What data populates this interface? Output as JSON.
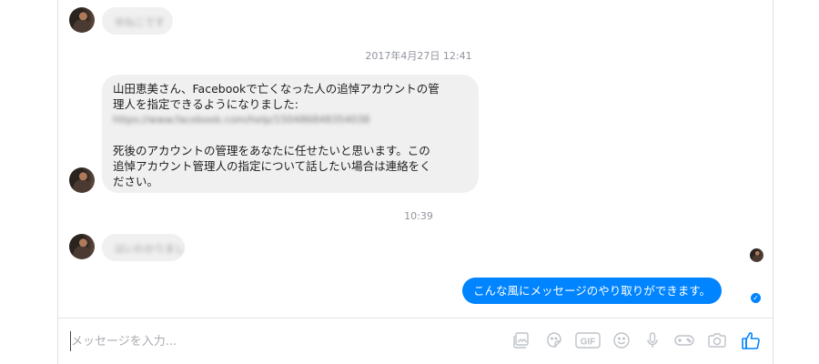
{
  "conversation": {
    "blurred_top": "ゆねこです",
    "timestamp1": "2017年4月27日 12:41",
    "card": {
      "line1": "山田恵美さん、Facebookで亡くなった人の追悼アカウントの管",
      "line2": "理人を指定できるようになりました:",
      "link": "https://www.facebook.com/help/150486848354038",
      "line3": "死後のアカウントの管理をあなたに任せたいと思います。この",
      "line4": "追悼アカウント管理人の指定について話したい場合は連絡をく",
      "line5": "ださい。"
    },
    "timestamp2": "10:39",
    "blurred_reply": "はいわかりました",
    "sent_message": "こんな風にメッセージのやり取りができます。",
    "seen_check": "✓"
  },
  "composer": {
    "placeholder": "メッセージを入力...",
    "value": ""
  },
  "toolbar": {
    "icons": [
      "image-icon",
      "sticker-icon",
      "gif-icon",
      "emoji-icon",
      "microphone-icon",
      "game-icon",
      "camera-icon",
      "like-icon"
    ],
    "gif_label": "GIF",
    "accent_color": "#0084ff",
    "icon_color": "#bec2c9"
  }
}
